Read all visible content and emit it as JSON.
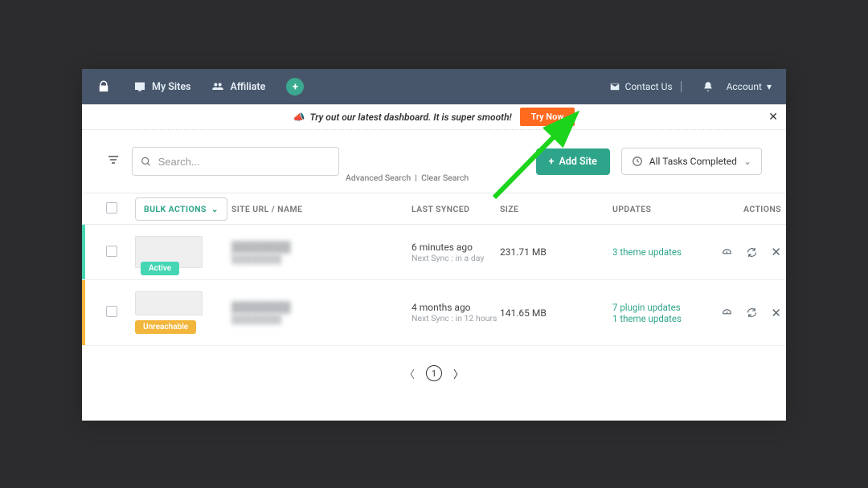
{
  "nav": {
    "my_sites": "My Sites",
    "affiliate": "Affiliate",
    "contact_us": "Contact Us",
    "account": "Account"
  },
  "banner": {
    "text": "Try out our latest dashboard. It is super smooth!",
    "try_now": "Try Now"
  },
  "toolbar": {
    "search_placeholder": "Search...",
    "advanced_search": "Advanced Search",
    "clear_search": "Clear Search",
    "add_site": "Add Site",
    "tasks_status": "All Tasks Completed"
  },
  "table": {
    "bulk_actions": "BULK ACTIONS",
    "headers": {
      "site": "SITE URL / NAME",
      "last_synced": "LAST SYNCED",
      "size": "SIZE",
      "updates": "UPDATES",
      "actions": "ACTIONS"
    },
    "rows": [
      {
        "status_label": "Active",
        "status_type": "active",
        "accent": "#46d6b3",
        "name": "████████",
        "url": "████████",
        "synced_main": "6 minutes ago",
        "synced_sub": "Next Sync : in a day",
        "size": "231.71 MB",
        "updates": [
          "3 theme updates"
        ]
      },
      {
        "status_label": "Unreachable",
        "status_type": "unreach",
        "accent": "#f2b63c",
        "name": "████████",
        "url": "████████",
        "synced_main": "4 months ago",
        "synced_sub": "Next Sync : in 12 hours",
        "size": "141.65 MB",
        "updates": [
          "7 plugin updates",
          "1 theme updates"
        ]
      }
    ]
  },
  "pagination": {
    "current": "1"
  }
}
